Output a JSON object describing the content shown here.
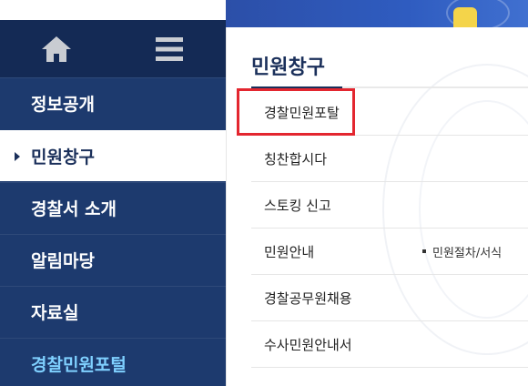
{
  "banner": {
    "partial_text": ""
  },
  "sidebar": {
    "home_icon": "home-icon",
    "menu_icon": "hamburger-menu-icon",
    "items": [
      {
        "label": "정보공개"
      },
      {
        "label": "민원창구"
      },
      {
        "label": "경찰서 소개"
      },
      {
        "label": "알림마당"
      },
      {
        "label": "자료실"
      },
      {
        "label": "경찰민원포털"
      }
    ]
  },
  "panel": {
    "title": "민원창구",
    "items": [
      {
        "label": "경찰민원포탈"
      },
      {
        "label": "칭찬합시다"
      },
      {
        "label": "스토킹 신고"
      },
      {
        "label": "민원안내",
        "sub": "민원절차/서식"
      },
      {
        "label": "경찰공무원채용"
      },
      {
        "label": "수사민원안내서"
      }
    ]
  },
  "colors": {
    "sidebar_bg": "#1d3a6e",
    "sidebar_top": "#142a55",
    "highlight_text": "#7fd0ff",
    "selection_box": "#e3262f"
  }
}
